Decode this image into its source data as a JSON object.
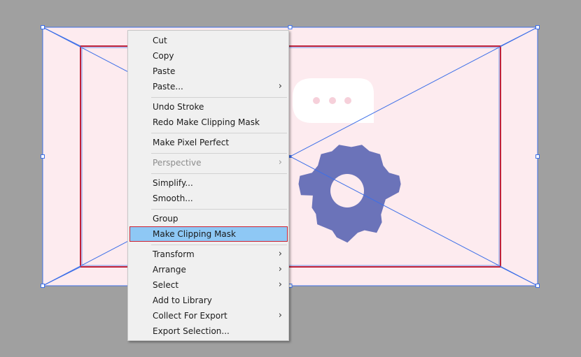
{
  "colors": {
    "workspace": "#a0a0a0",
    "artboard_fill": "#fdebef",
    "selection_blue": "#3d6fe8",
    "clip_red": "#c0223a",
    "gear": "#6b73b9",
    "bubble": "#ffffff",
    "bubble_dots": "#f6d0da",
    "menu_bg": "#f0f0f0",
    "menu_highlight": "#8ec8f5"
  },
  "canvas": {
    "bubble_icon": "chat-bubble-icon",
    "gear_icon": "gear-icon"
  },
  "context_menu": {
    "items": [
      {
        "label": "Cut",
        "submenu": false,
        "disabled": false
      },
      {
        "label": "Copy",
        "submenu": false,
        "disabled": false
      },
      {
        "label": "Paste",
        "submenu": false,
        "disabled": false
      },
      {
        "label": "Paste...",
        "submenu": true,
        "disabled": false
      },
      {
        "label": "Undo Stroke",
        "submenu": false,
        "disabled": false
      },
      {
        "label": "Redo Make Clipping Mask",
        "submenu": false,
        "disabled": false
      },
      {
        "label": "Make Pixel Perfect",
        "submenu": false,
        "disabled": false
      },
      {
        "label": "Perspective",
        "submenu": true,
        "disabled": true
      },
      {
        "label": "Simplify...",
        "submenu": false,
        "disabled": false
      },
      {
        "label": "Smooth...",
        "submenu": false,
        "disabled": false
      },
      {
        "label": "Group",
        "submenu": false,
        "disabled": false
      },
      {
        "label": "Make Clipping Mask",
        "submenu": false,
        "disabled": false,
        "highlighted": true
      },
      {
        "label": "Transform",
        "submenu": true,
        "disabled": false
      },
      {
        "label": "Arrange",
        "submenu": true,
        "disabled": false
      },
      {
        "label": "Select",
        "submenu": true,
        "disabled": false
      },
      {
        "label": "Add to Library",
        "submenu": false,
        "disabled": false
      },
      {
        "label": "Collect For Export",
        "submenu": true,
        "disabled": false
      },
      {
        "label": "Export Selection...",
        "submenu": false,
        "disabled": false
      }
    ]
  }
}
